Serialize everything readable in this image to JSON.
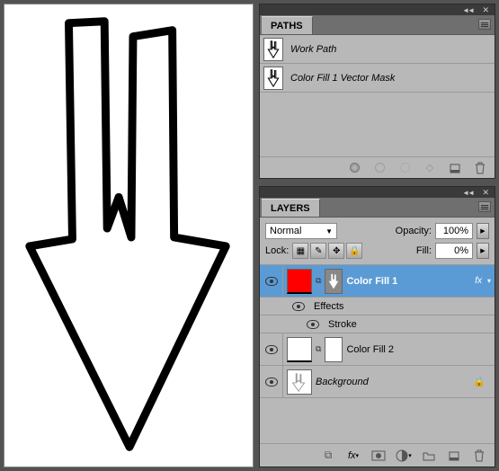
{
  "paths_panel": {
    "title": "PATHS",
    "items": [
      {
        "name": "Work Path"
      },
      {
        "name": "Color Fill 1 Vector Mask"
      }
    ]
  },
  "layers_panel": {
    "title": "LAYERS",
    "blend_mode": "Normal",
    "opacity_label": "Opacity:",
    "opacity_value": "100%",
    "lock_label": "Lock:",
    "fill_label": "Fill:",
    "fill_value": "0%",
    "layers": [
      {
        "name": "Color Fill 1",
        "selected": true,
        "has_fx": true,
        "thumb": "red",
        "has_mask": true
      },
      {
        "name": "Color Fill 2",
        "selected": false,
        "has_fx": false,
        "thumb": "white",
        "has_mask": false
      },
      {
        "name": "Background",
        "selected": false,
        "has_fx": false,
        "thumb": "arrow",
        "locked": true
      }
    ],
    "effects_label": "Effects",
    "stroke_label": "Stroke",
    "fx_text": "fx"
  }
}
